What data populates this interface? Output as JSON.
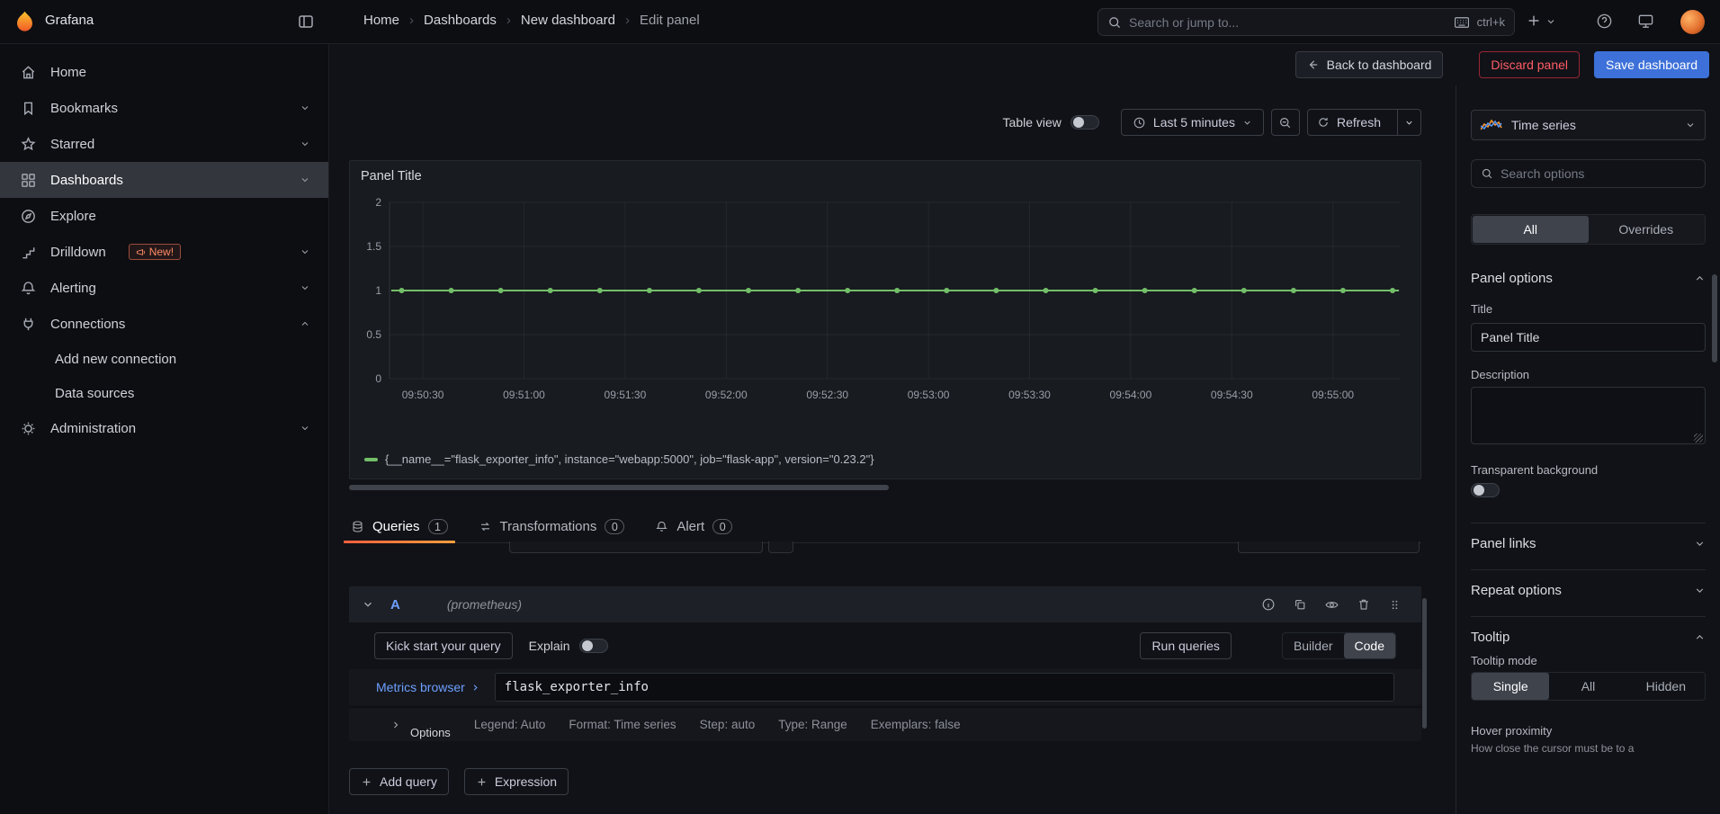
{
  "colors": {
    "accent_blue": "#3d71d9",
    "link_blue": "#6e9fff",
    "orange": "#ff8833",
    "green": "#73bf69",
    "red": "#e02f44"
  },
  "top_nav": {
    "brand": "Grafana",
    "breadcrumbs": [
      "Home",
      "Dashboards",
      "New dashboard",
      "Edit panel"
    ],
    "search_placeholder": "Search or jump to...",
    "search_shortcut": "ctrl+k"
  },
  "toolbar": {
    "back": "Back to dashboard",
    "discard": "Discard panel",
    "save": "Save dashboard"
  },
  "controls": {
    "table_view": "Table view",
    "time_range": "Last 5 minutes",
    "refresh": "Refresh"
  },
  "sidebar": {
    "items": [
      {
        "label": "Home"
      },
      {
        "label": "Bookmarks"
      },
      {
        "label": "Starred"
      },
      {
        "label": "Dashboards"
      },
      {
        "label": "Explore"
      },
      {
        "label": "Drilldown",
        "badge": "New!"
      },
      {
        "label": "Alerting"
      },
      {
        "label": "Connections"
      },
      {
        "label": "Add new connection"
      },
      {
        "label": "Data sources"
      },
      {
        "label": "Administration"
      }
    ]
  },
  "panel": {
    "title": "Panel Title",
    "legend": "{__name__=\"flask_exporter_info\", instance=\"webapp:5000\", job=\"flask-app\", version=\"0.23.2\"}"
  },
  "chart_data": {
    "type": "line",
    "title": "Panel Title",
    "x_ticks": [
      "09:50:30",
      "09:51:00",
      "09:51:30",
      "09:52:00",
      "09:52:30",
      "09:53:00",
      "09:53:30",
      "09:54:00",
      "09:54:30",
      "09:55:00"
    ],
    "x_range": [
      "09:50:20",
      "09:55:15"
    ],
    "y_ticks": [
      "0",
      "0.5",
      "1",
      "1.5",
      "2"
    ],
    "ylim": [
      0,
      2
    ],
    "grid": true,
    "legend_position": "bottom",
    "series": [
      {
        "name": "{__name__=\"flask_exporter_info\", instance=\"webapp:5000\", job=\"flask-app\", version=\"0.23.2\"}",
        "color": "#73bf69",
        "constant_value": 1,
        "point_interval_seconds": 15
      }
    ]
  },
  "query_editor": {
    "tabs": [
      {
        "label": "Queries",
        "count": "1"
      },
      {
        "label": "Transformations",
        "count": "0"
      },
      {
        "label": "Alert",
        "count": "0"
      }
    ],
    "ref_id": "A",
    "datasource": "(prometheus)",
    "kick_start": "Kick start your query",
    "explain": "Explain",
    "run_queries": "Run queries",
    "builder": "Builder",
    "code": "Code",
    "metrics_browser": "Metrics browser",
    "query": "flask_exporter_info",
    "options_label": "Options",
    "options_meta": [
      "Legend: Auto",
      "Format: Time series",
      "Step: auto",
      "Type: Range",
      "Exemplars: false"
    ],
    "add_query": "Add query",
    "expression": "Expression"
  },
  "options_pane": {
    "visualization": "Time series",
    "search_placeholder": "Search options",
    "tabs": {
      "all": "All",
      "overrides": "Overrides"
    },
    "panel_options": {
      "heading": "Panel options",
      "title_label": "Title",
      "title_value": "Panel Title",
      "description_label": "Description",
      "transparent_label": "Transparent background"
    },
    "panel_links": "Panel links",
    "repeat_options": "Repeat options",
    "tooltip": {
      "heading": "Tooltip",
      "mode_label": "Tooltip mode",
      "modes": [
        "Single",
        "All",
        "Hidden"
      ],
      "hover_label": "Hover proximity",
      "hover_help": "How close the cursor must be to a"
    }
  }
}
